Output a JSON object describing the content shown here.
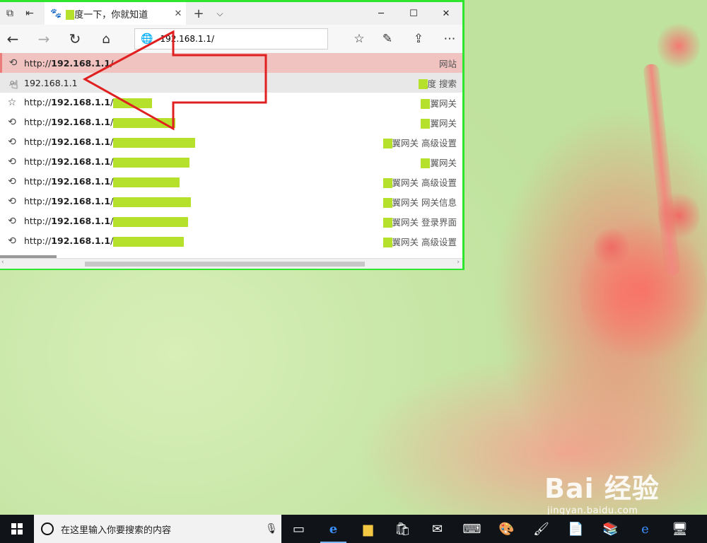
{
  "browser": {
    "tab": {
      "title": "度一下，你就知道"
    },
    "address": {
      "value": "192.168.1.1/"
    },
    "suggestions": [
      {
        "icon": "history-icon",
        "prefix": "http://",
        "host": "192.168.1.1",
        "path": "/",
        "tag": "网站",
        "style": "hl"
      },
      {
        "icon": "search-icon",
        "prefix": "",
        "host": "",
        "path": "192.168.1.1",
        "tag": "度 搜索",
        "style": "sel"
      },
      {
        "icon": "star-icon",
        "prefix": "http://",
        "host": "192.168.1.1",
        "path": "/",
        "tag": "翼网关",
        "style": ""
      },
      {
        "icon": "history-icon",
        "prefix": "http://",
        "host": "192.168.1.1",
        "path": "/",
        "tag": "翼网关",
        "style": ""
      },
      {
        "icon": "history-icon",
        "prefix": "http://",
        "host": "192.168.1.1",
        "path": "/",
        "tag": "翼网关 高级设置",
        "style": ""
      },
      {
        "icon": "history-icon",
        "prefix": "http://",
        "host": "192.168.1.1",
        "path": "/",
        "tag": "翼网关",
        "style": ""
      },
      {
        "icon": "history-icon",
        "prefix": "http://",
        "host": "192.168.1.1",
        "path": "/",
        "tag": "翼网关 高级设置",
        "style": ""
      },
      {
        "icon": "history-icon",
        "prefix": "http://",
        "host": "192.168.1.1",
        "path": "/",
        "tag": "翼网关 网关信息",
        "style": ""
      },
      {
        "icon": "history-icon",
        "prefix": "http://",
        "host": "192.168.1.1",
        "path": "/",
        "tag": "翼网关 登录界面",
        "style": ""
      },
      {
        "icon": "history-icon",
        "prefix": "http://",
        "host": "192.168.1.1",
        "path": "/",
        "tag": "翼网关 高级设置",
        "style": ""
      }
    ]
  },
  "taskbar": {
    "search_placeholder": "在这里输入你要搜索的内容"
  },
  "watermark": {
    "big": "Bai 经验",
    "small": "jingyan.baidu.com"
  },
  "colors": {
    "frame": "#2ee62e",
    "highlight_row": "#f0c2c0",
    "arrow": "#e02020",
    "mask": "#b5e02c"
  }
}
